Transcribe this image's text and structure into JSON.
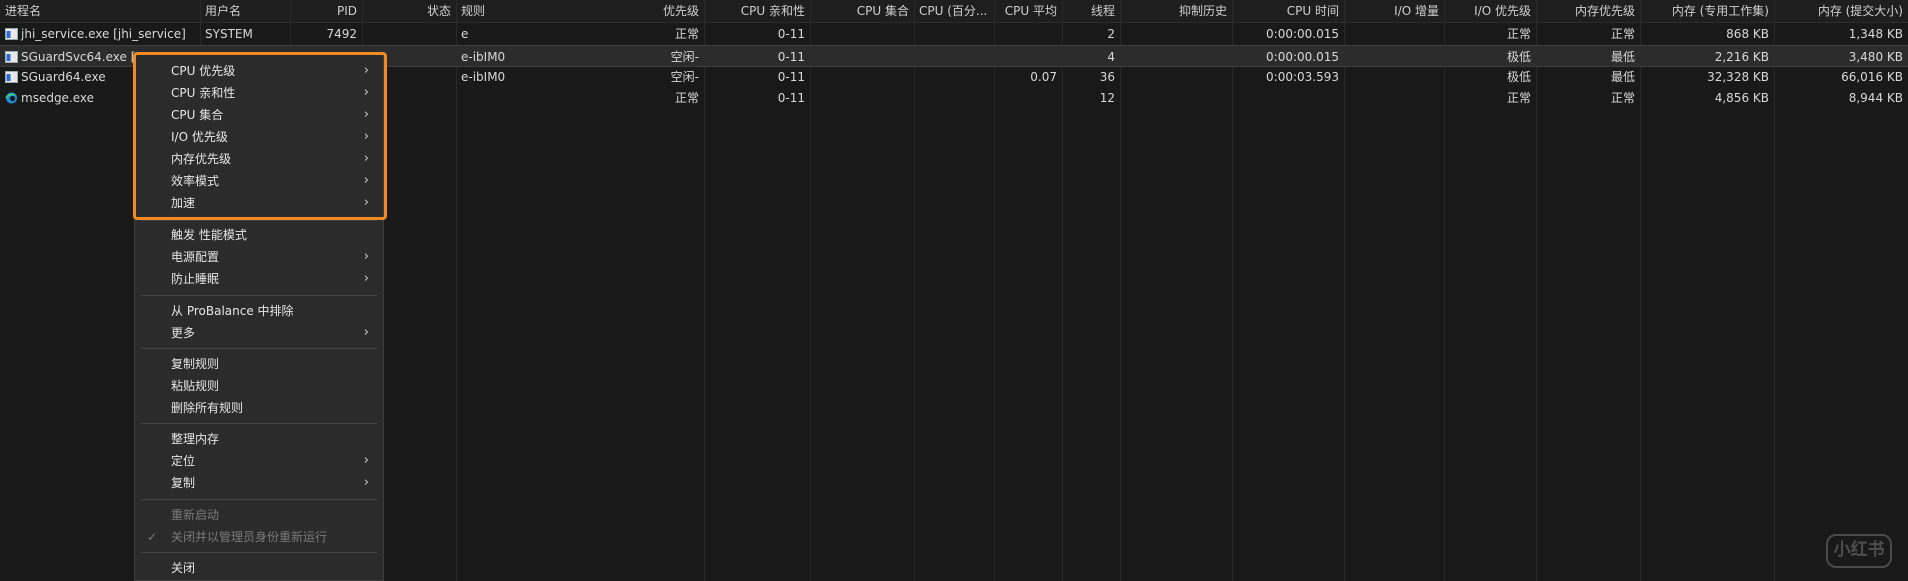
{
  "columns": [
    "进程名",
    "用户名",
    "PID",
    "状态",
    "规则",
    "优先级",
    "CPU 亲和性",
    "CPU 集合",
    "CPU (百分...",
    "CPU 平均",
    "线程",
    "抑制历史",
    "CPU 时间",
    "I/O 增量",
    "I/O 优先级",
    "内存优先级",
    "内存 (专用工作集)",
    "内存 (提交大小)"
  ],
  "rows": [
    {
      "name": "jhi_service.exe [jhi_service]",
      "user": "SYSTEM",
      "pid": "7492",
      "status": "",
      "rule": "e",
      "priority": "正常",
      "affinity": "0-11",
      "cpuset": "",
      "cpupct": "",
      "cpuavg": "",
      "threads": "2",
      "throttle": "",
      "cputime": "0:00:00.015",
      "io_delta": "",
      "io_priority": "正常",
      "mem_priority": "正常",
      "mem_ws": "868 KB",
      "mem_commit": "1,348 KB",
      "icon": "service-window-icon"
    },
    {
      "name": "SGuardSvc64.exe [A",
      "user": "",
      "pid": "",
      "status": "",
      "rule": "e-ibIM0",
      "priority": "空闲-",
      "affinity": "0-11",
      "cpuset": "",
      "cpupct": "",
      "cpuavg": "",
      "threads": "4",
      "throttle": "",
      "cputime": "0:00:00.015",
      "io_delta": "",
      "io_priority": "极低",
      "mem_priority": "最低",
      "mem_ws": "2,216 KB",
      "mem_commit": "3,480 KB",
      "icon": "service-window-icon"
    },
    {
      "name": "SGuard64.exe",
      "user": "",
      "pid": "",
      "status": "",
      "rule": "e-ibIM0",
      "priority": "空闲-",
      "affinity": "0-11",
      "cpuset": "",
      "cpupct": "",
      "cpuavg": "0.07",
      "threads": "36",
      "throttle": "",
      "cputime": "0:00:03.593",
      "io_delta": "",
      "io_priority": "极低",
      "mem_priority": "最低",
      "mem_ws": "32,328 KB",
      "mem_commit": "66,016 KB",
      "icon": "service-window-icon"
    },
    {
      "name": "msedge.exe",
      "user": "",
      "pid": "",
      "status": "",
      "rule": "",
      "priority": "正常",
      "affinity": "0-11",
      "cpuset": "",
      "cpupct": "",
      "cpuavg": "",
      "threads": "12",
      "throttle": "",
      "cputime": "",
      "io_delta": "",
      "io_priority": "正常",
      "mem_priority": "正常",
      "mem_ws": "4,856 KB",
      "mem_commit": "8,944 KB",
      "icon": "edge-icon"
    }
  ],
  "menu": {
    "cpu_priority": "CPU 优先级",
    "cpu_affinity": "CPU 亲和性",
    "cpu_sets": "CPU 集合",
    "io_priority": "I/O 优先级",
    "mem_priority": "内存优先级",
    "efficiency": "效率模式",
    "boost": "加速",
    "trigger_perf": "触发 性能模式",
    "power_profile": "电源配置",
    "prevent_sleep": "防止睡眠",
    "exclude_probalance": "从 ProBalance 中排除",
    "more": "更多",
    "copy_rules": "复制规则",
    "paste_rules": "粘贴规则",
    "delete_rules": "删除所有规则",
    "trim_memory": "整理内存",
    "locate": "定位",
    "copy": "复制",
    "restart": "重新启动",
    "close_restart_admin": "关闭并以管理员身份重新运行",
    "close": "关闭"
  },
  "watermark": "小红书",
  "colors": {
    "background": "#191919",
    "menu_bg": "#2b2b2b",
    "highlight": "#f08a22",
    "text": "#d4d4d4",
    "disabled": "#7a7a7a"
  }
}
